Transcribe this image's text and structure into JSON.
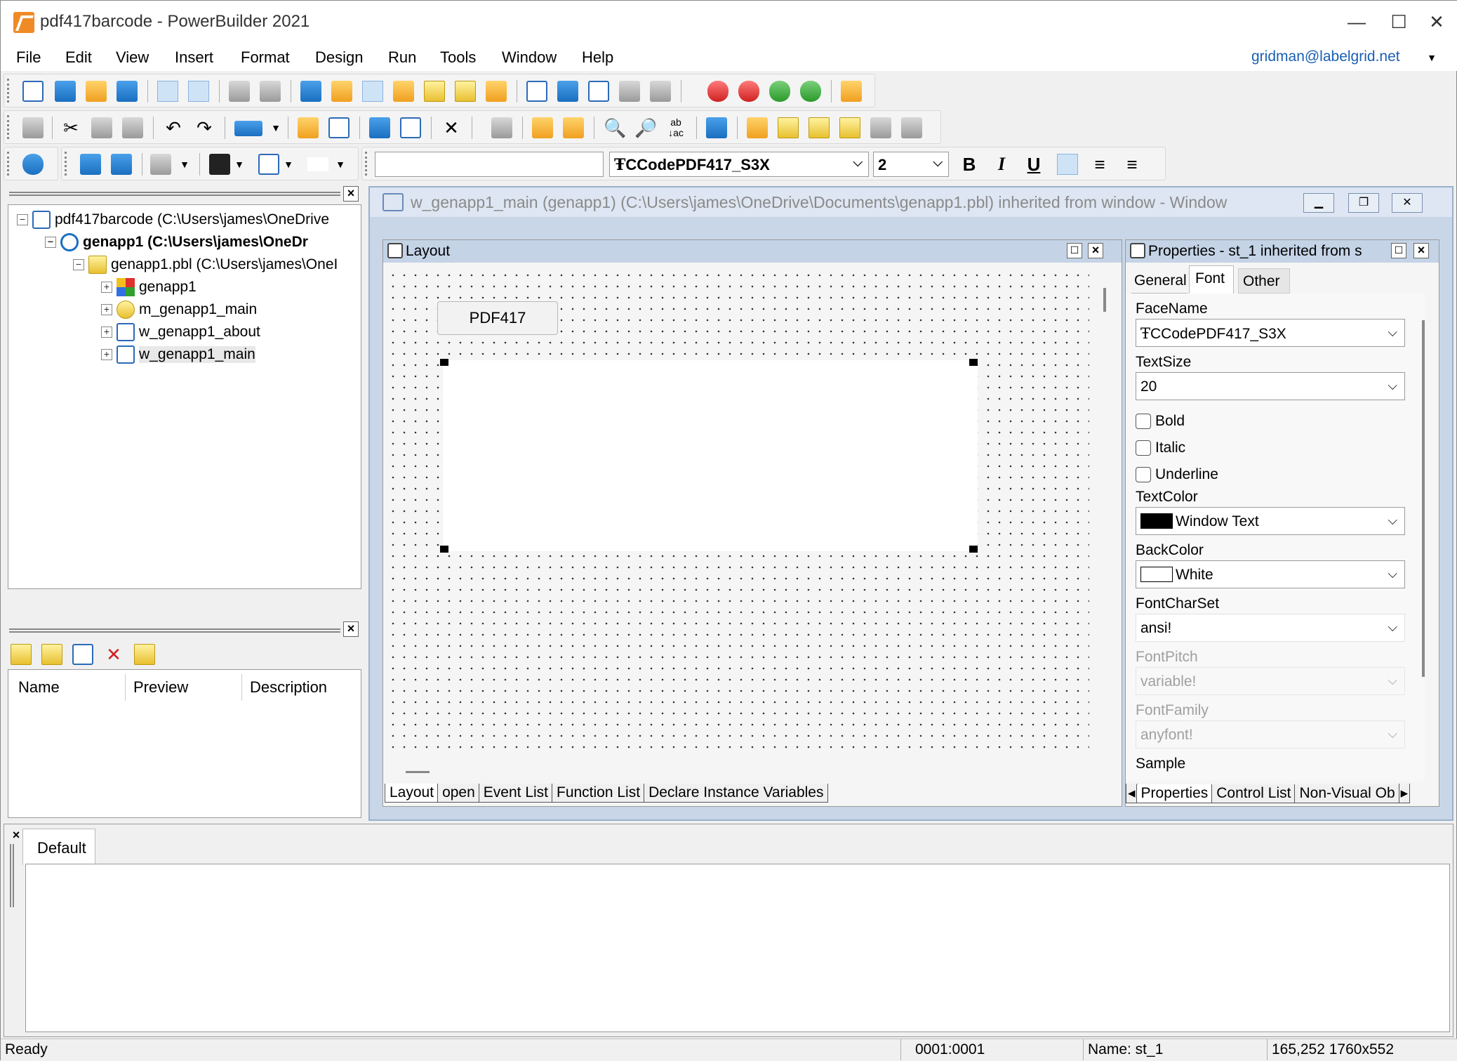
{
  "window": {
    "title": "pdf417barcode - PowerBuilder 2021",
    "minimize": "—",
    "maximize": "☐",
    "close": "✕"
  },
  "menu": {
    "items": [
      "File",
      "Edit",
      "View",
      "Insert",
      "Format",
      "Design",
      "Run",
      "Tools",
      "Window",
      "Help"
    ],
    "user": "gridman@labelgrid.net"
  },
  "format_toolbar": {
    "font_name": "CCodePDF417_S3X",
    "font_size": "2",
    "bold": "B",
    "italic": "I",
    "underline": "U"
  },
  "system_tree": {
    "items": [
      {
        "label": "pdf417barcode (C:\\Users\\james\\OneDrive"
      },
      {
        "label": "genapp1 (C:\\Users\\james\\OneDr"
      },
      {
        "label": "genapp1.pbl (C:\\Users\\james\\OneI"
      },
      {
        "label": "genapp1"
      },
      {
        "label": "m_genapp1_main"
      },
      {
        "label": "w_genapp1_about"
      },
      {
        "label": "w_genapp1_main"
      }
    ]
  },
  "clip_panel": {
    "columns": [
      "Name",
      "Preview",
      "Description"
    ]
  },
  "painter": {
    "title": "w_genapp1_main (genapp1) (C:\\Users\\james\\OneDrive\\Documents\\genapp1.pbl) inherited from window - Window",
    "layout_title": "Layout",
    "button_text": "PDF417",
    "tabs": [
      "Layout",
      "open",
      "Event List",
      "Function List",
      "Declare Instance Variables"
    ]
  },
  "properties": {
    "title": "Properties - st_1 inherited from s",
    "tabs": [
      "General",
      "Font",
      "Other"
    ],
    "active_tab": "Font",
    "facename_label": "FaceName",
    "facename_value": "CCodePDF417_S3X",
    "textsize_label": "TextSize",
    "textsize_value": "20",
    "bold_label": "Bold",
    "italic_label": "Italic",
    "underline_label": "Underline",
    "textcolor_label": "TextColor",
    "textcolor_value": "Window Text",
    "backcolor_label": "BackColor",
    "backcolor_value": "White",
    "fontcharset_label": "FontCharSet",
    "fontcharset_value": "ansi!",
    "fontpitch_label": "FontPitch",
    "fontpitch_value": "variable!",
    "fontfamily_label": "FontFamily",
    "fontfamily_value": "anyfont!",
    "sample_label": "Sample",
    "bottom_tabs": [
      "Properties",
      "Control List",
      "Non-Visual Ob"
    ]
  },
  "output": {
    "tab": "Default"
  },
  "status": {
    "text": "Ready",
    "position": "0001:0001",
    "name": "Name: st_1",
    "geometry": "165,252 1760x552"
  },
  "colors": {
    "accent": "#1a5fb4",
    "titlebar_child": "#dde6f2",
    "pane_head": "#c4d3e6"
  }
}
